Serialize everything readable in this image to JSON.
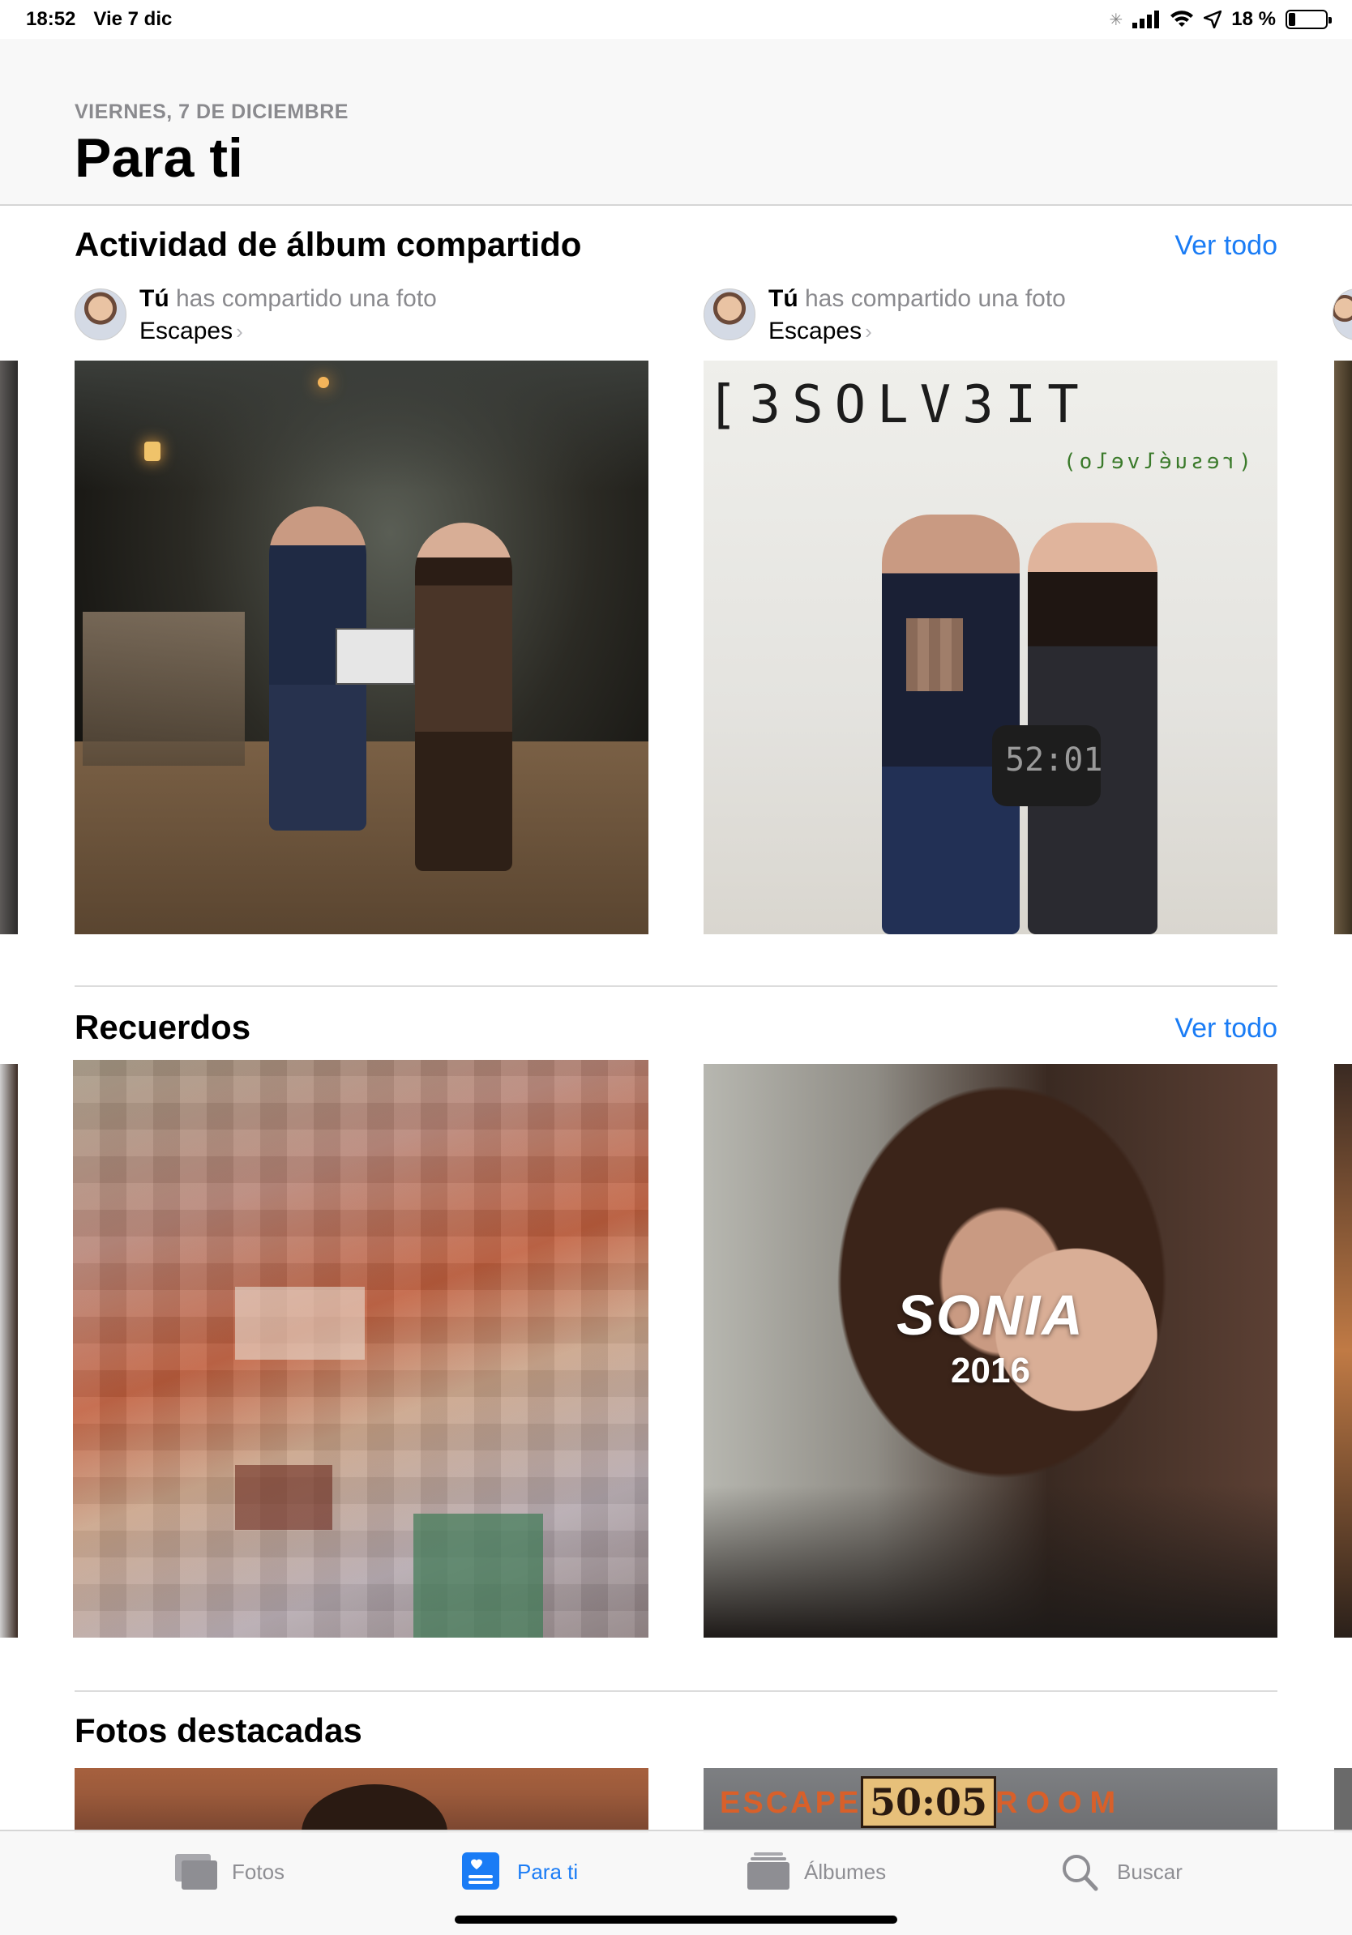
{
  "status_bar": {
    "time": "18:52",
    "date": "Vie 7 dic",
    "battery_percent": "18 %",
    "battery_level": 0.18
  },
  "header": {
    "date": "VIERNES, 7 DE DICIEMBRE",
    "title": "Para ti"
  },
  "shared_activity": {
    "title": "Actividad de álbum compartido",
    "see_all": "Ver todo",
    "items": [
      {
        "user": "Tú",
        "action": "has compartido una foto",
        "album": "Escapes"
      },
      {
        "user": "Tú",
        "action": "has compartido una foto",
        "album": "Escapes"
      }
    ],
    "photo2_sign": "[3SOLV3IT",
    "photo2_sub": "(resuélvelo)",
    "photo2_board": "52:01"
  },
  "memories": {
    "title": "Recuerdos",
    "see_all": "Ver todo",
    "items": [
      {
        "name": "",
        "year": ""
      },
      {
        "name": "SONIA",
        "year": "2016"
      }
    ]
  },
  "featured": {
    "title": "Fotos destacadas",
    "photo2_sign": "ESCAPE",
    "photo2_timer": "50:05",
    "photo2_room": "ROOM"
  },
  "tab_bar": {
    "tabs": [
      {
        "label": "Fotos",
        "icon": "photos-icon",
        "active": false
      },
      {
        "label": "Para ti",
        "icon": "for-you-icon",
        "active": true
      },
      {
        "label": "Álbumes",
        "icon": "albums-icon",
        "active": false
      },
      {
        "label": "Buscar",
        "icon": "search-icon",
        "active": false
      }
    ],
    "accent": "#1a7cf5"
  }
}
